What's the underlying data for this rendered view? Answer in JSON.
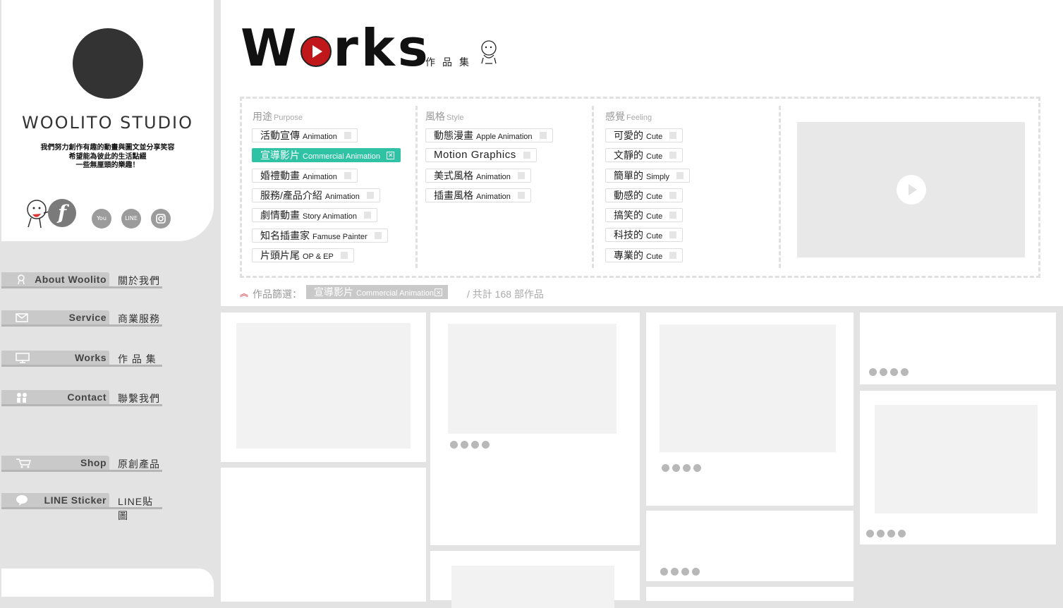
{
  "sidebar": {
    "studio_name": "WOOLITO STUDIO",
    "tagline": [
      "我們努力創作有趣的動畫與圖文並分享笑容",
      "希望能為彼此的生活點綴",
      "一些無厘頭的樂趣！"
    ],
    "social": {
      "facebook": "f",
      "youtube": "You Tube",
      "line": "LINE",
      "instagram": "instagram-icon"
    },
    "nav": [
      {
        "en": "About Woolito",
        "zh": "關於我們",
        "icon": "mascot-icon"
      },
      {
        "en": "Service",
        "zh": "商業服務",
        "icon": "envelope-icon"
      },
      {
        "en": "Works",
        "zh": "作 品 集",
        "icon": "monitor-icon"
      },
      {
        "en": "Contact",
        "zh": "聯繫我們",
        "icon": "people-icon"
      },
      {
        "en": "Shop",
        "zh": "原創產品",
        "icon": "cart-icon"
      },
      {
        "en": "LINE Sticker",
        "zh": "LINE貼圖",
        "icon": "speech-bubble-icon"
      }
    ]
  },
  "header": {
    "title_pre": "W",
    "title_post": "rks",
    "title_zh": "作品集"
  },
  "filters": {
    "purpose": {
      "label": "用途",
      "label_en": "Purpose",
      "items": [
        {
          "zh": "活動宣傳",
          "en": "Animation",
          "active": false
        },
        {
          "zh": "宣導影片",
          "en": "Commercial Animation",
          "active": true
        },
        {
          "zh": "婚禮動畫",
          "en": "Animation",
          "active": false
        },
        {
          "zh": "服務/產品介紹",
          "en": "Animation",
          "active": false
        },
        {
          "zh": "劇情動畫",
          "en": "Story Animation",
          "active": false
        },
        {
          "zh": "知名插畫家",
          "en": "Famuse Painter",
          "active": false
        },
        {
          "zh": "片頭片尾",
          "en": "OP & EP",
          "active": false
        }
      ]
    },
    "style": {
      "label": "風格",
      "label_en": "Style",
      "items": [
        {
          "zh": "動態漫畫",
          "en": "Apple Animation"
        },
        {
          "zh": "Motion Graphics",
          "en": ""
        },
        {
          "zh": "美式風格",
          "en": "Animation"
        },
        {
          "zh": "插畫風格",
          "en": "Animation"
        }
      ]
    },
    "feeling": {
      "label": "感覺",
      "label_en": "Feeling",
      "items": [
        {
          "zh": "可愛的",
          "en": "Cute"
        },
        {
          "zh": "文靜的",
          "en": "Cute"
        },
        {
          "zh": "簡單的",
          "en": "Simply"
        },
        {
          "zh": "動感的",
          "en": "Cute"
        },
        {
          "zh": "搞笑的",
          "en": "Cute"
        },
        {
          "zh": "科技的",
          "en": "Cute"
        },
        {
          "zh": "專業的",
          "en": "Cute"
        }
      ]
    }
  },
  "filter_status": {
    "label": "作品篩選：",
    "selected_zh": "宣導影片",
    "selected_en": "Commercial Animation",
    "total": "/ 共計 168 部作品"
  },
  "colors": {
    "accent": "#2fc2a5",
    "brand_red": "#c0181a",
    "chip_grey": "#c9c9c9"
  }
}
